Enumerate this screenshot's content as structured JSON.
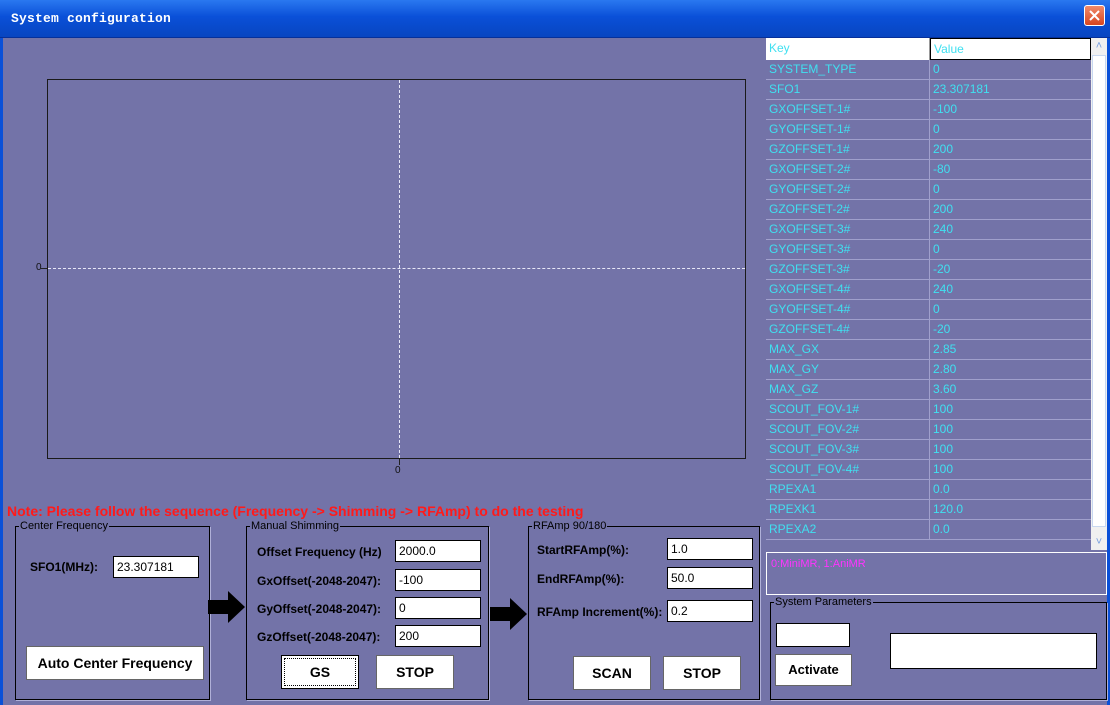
{
  "window": {
    "title": "System configuration"
  },
  "plot": {
    "y_zero_label": "0",
    "x_zero_label": "0"
  },
  "note": "Note: Please follow the sequence (Frequency -> Shimming -> RFAmp) to do the testing",
  "center_frequency": {
    "legend": "Center Frequency",
    "sfo1_label": "SFO1(MHz):",
    "sfo1_value": "23.307181",
    "auto_button": "Auto Center Frequency"
  },
  "manual_shimming": {
    "legend": "Manual Shimming",
    "offset_label": "Offset Frequency (Hz)",
    "offset_value": "2000.0",
    "gx_label": "GxOffset(-2048-2047):",
    "gx_value": "-100",
    "gy_label": "GyOffset(-2048-2047):",
    "gy_value": "0",
    "gz_label": "GzOffset(-2048-2047):",
    "gz_value": "200",
    "gs_button": "GS",
    "stop_button": "STOP"
  },
  "rfamp": {
    "legend": "RFAmp 90/180",
    "start_label": "StartRFAmp(%):",
    "start_value": "1.0",
    "end_label": "EndRFAmp(%):",
    "end_value": "50.0",
    "inc_label": "RFAmp Increment(%):",
    "inc_value": "0.2",
    "scan_button": "SCAN",
    "stop_button": "STOP"
  },
  "param_table": {
    "headers": {
      "key": "Key",
      "value": "Value"
    },
    "rows": [
      {
        "key": "SYSTEM_TYPE",
        "value": "0"
      },
      {
        "key": "SFO1",
        "value": "23.307181"
      },
      {
        "key": "GXOFFSET-1#",
        "value": "-100"
      },
      {
        "key": "GYOFFSET-1#",
        "value": "0"
      },
      {
        "key": "GZOFFSET-1#",
        "value": "200"
      },
      {
        "key": "GXOFFSET-2#",
        "value": "-80"
      },
      {
        "key": "GYOFFSET-2#",
        "value": "0"
      },
      {
        "key": "GZOFFSET-2#",
        "value": "200"
      },
      {
        "key": "GXOFFSET-3#",
        "value": "240"
      },
      {
        "key": "GYOFFSET-3#",
        "value": "0"
      },
      {
        "key": "GZOFFSET-3#",
        "value": "-20"
      },
      {
        "key": "GXOFFSET-4#",
        "value": "240"
      },
      {
        "key": "GYOFFSET-4#",
        "value": "0"
      },
      {
        "key": "GZOFFSET-4#",
        "value": "-20"
      },
      {
        "key": "MAX_GX",
        "value": "2.85"
      },
      {
        "key": "MAX_GY",
        "value": "2.80"
      },
      {
        "key": "MAX_GZ",
        "value": "3.60"
      },
      {
        "key": "SCOUT_FOV-1#",
        "value": "100"
      },
      {
        "key": "SCOUT_FOV-2#",
        "value": "100"
      },
      {
        "key": "SCOUT_FOV-3#",
        "value": "100"
      },
      {
        "key": "SCOUT_FOV-4#",
        "value": "100"
      },
      {
        "key": "RPEXA1",
        "value": "0.0"
      },
      {
        "key": "RPEXK1",
        "value": "120.0"
      },
      {
        "key": "RPEXA2",
        "value": "0.0"
      }
    ]
  },
  "info_text": "0:MiniMR, 1:AniMR",
  "system_parameters": {
    "legend": "System Parameters",
    "code_value": "",
    "activate_button": "Activate",
    "status_value": ""
  },
  "colors": {
    "background": "#7373a8",
    "table_text": "#40e0f0",
    "note": "#ff1a1a",
    "info": "#ff33ff"
  }
}
